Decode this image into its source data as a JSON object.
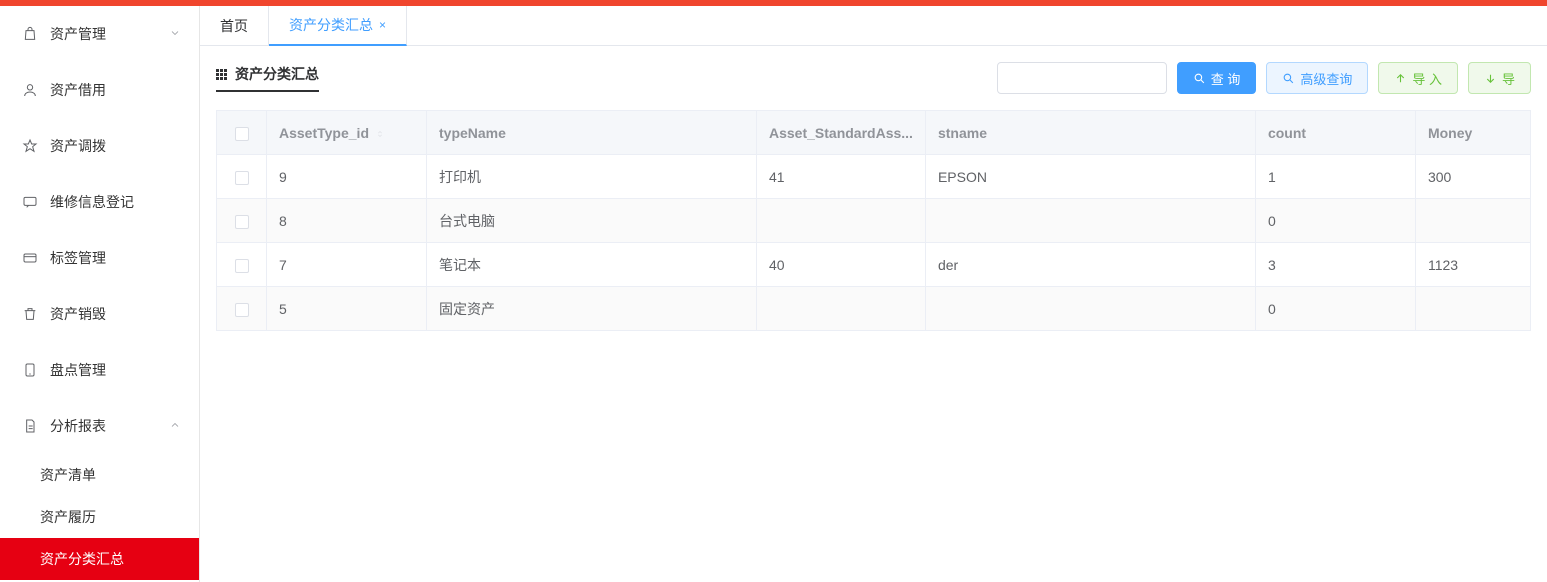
{
  "sidebar": {
    "items": [
      {
        "label": "资产管理",
        "icon": "bag",
        "expand": "down"
      },
      {
        "label": "资产借用",
        "icon": "user"
      },
      {
        "label": "资产调拨",
        "icon": "star"
      },
      {
        "label": "维修信息登记",
        "icon": "message"
      },
      {
        "label": "标签管理",
        "icon": "card"
      },
      {
        "label": "资产销毁",
        "icon": "trash"
      },
      {
        "label": "盘点管理",
        "icon": "tablet"
      },
      {
        "label": "分析报表",
        "icon": "doc",
        "expand": "up"
      }
    ],
    "sub": [
      {
        "label": "资产清单"
      },
      {
        "label": "资产履历"
      },
      {
        "label": "资产分类汇总",
        "active": true
      }
    ]
  },
  "tabs": [
    {
      "label": "首页",
      "closable": false,
      "active": false
    },
    {
      "label": "资产分类汇总",
      "closable": true,
      "active": true
    }
  ],
  "page": {
    "title": "资产分类汇总"
  },
  "actions": {
    "search_placeholder": "",
    "query": "查 询",
    "advanced": "高级查询",
    "import": "导 入",
    "export": "导"
  },
  "table": {
    "columns": [
      "AssetType_id",
      "typeName",
      "Asset_StandardAss...",
      "stname",
      "count",
      "Money"
    ],
    "rows": [
      {
        "AssetType_id": "9",
        "typeName": "打印机",
        "Asset_StandardAss": "41",
        "stname": "EPSON",
        "count": "1",
        "Money": "300"
      },
      {
        "AssetType_id": "8",
        "typeName": "台式电脑",
        "Asset_StandardAss": "",
        "stname": "",
        "count": "0",
        "Money": ""
      },
      {
        "AssetType_id": "7",
        "typeName": "笔记本",
        "Asset_StandardAss": "40",
        "stname": "der",
        "count": "3",
        "Money": "1123"
      },
      {
        "AssetType_id": "5",
        "typeName": "固定资产",
        "Asset_StandardAss": "",
        "stname": "",
        "count": "0",
        "Money": ""
      }
    ]
  }
}
